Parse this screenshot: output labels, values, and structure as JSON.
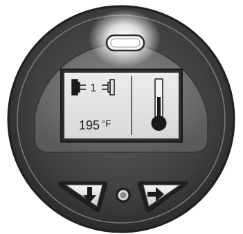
{
  "device": {
    "status_light": "indicator-led",
    "display": {
      "hours_value": "1",
      "temperature_value": "195",
      "temperature_unit": "°F",
      "left_icon": "glow-plug-icon",
      "right_icon": "thermometer-icon"
    },
    "buttons": {
      "down": "down-arrow-icon",
      "center": "center-button",
      "next": "right-arrow-icon"
    },
    "colors": {
      "bezel_outer": "#3f3f3f",
      "bezel_inner": "#6e6e6e",
      "lcd_background": "#e6e6e6",
      "lcd_ink": "#1a1a1a",
      "led_glow": "#ffffff"
    }
  }
}
